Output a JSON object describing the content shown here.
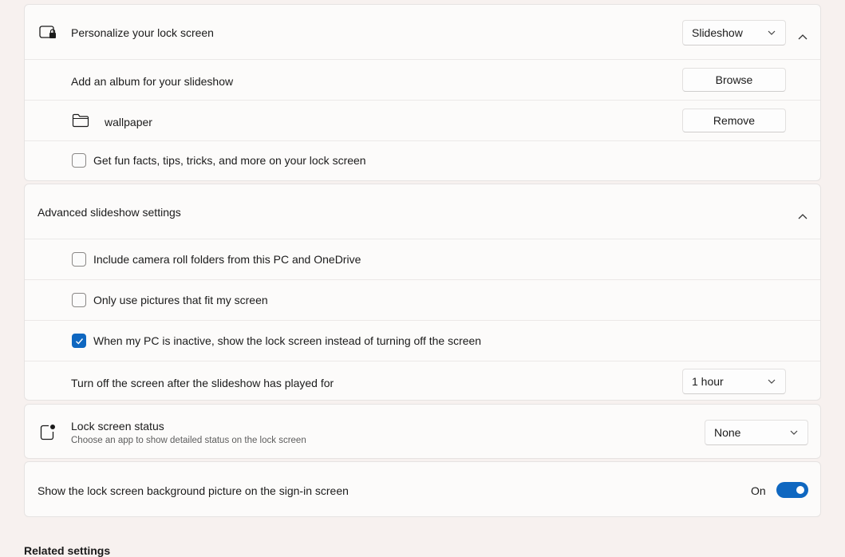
{
  "personalize": {
    "title": "Personalize your lock screen",
    "icon": "lock-screen-icon",
    "dropdown_value": "Slideshow",
    "album_label": "Add an album for your slideshow",
    "browse_label": "Browse",
    "folder_icon": "folder-icon",
    "folder_name": "wallpaper",
    "remove_label": "Remove",
    "fun_facts_label": "Get fun facts, tips, tricks, and more on your lock screen",
    "fun_facts_checked": false
  },
  "advanced": {
    "title": "Advanced slideshow settings",
    "options": [
      {
        "label": "Include camera roll folders from this PC and OneDrive",
        "checked": false
      },
      {
        "label": "Only use pictures that fit my screen",
        "checked": false
      },
      {
        "label": "When my PC is inactive, show the lock screen instead of turning off the screen",
        "checked": true
      }
    ],
    "turn_off_label": "Turn off the screen after the slideshow has played for",
    "turn_off_value": "1 hour"
  },
  "status": {
    "title": "Lock screen status",
    "subtitle": "Choose an app to show detailed status on the lock screen",
    "icon": "lock-status-icon",
    "dropdown_value": "None"
  },
  "signin": {
    "label": "Show the lock screen background picture on the sign-in screen",
    "state_label": "On",
    "enabled": true
  },
  "related": {
    "heading": "Related settings"
  },
  "colors": {
    "accent": "#0f67c0",
    "background": "#f7f1ef",
    "card": "#fcfbfa"
  }
}
